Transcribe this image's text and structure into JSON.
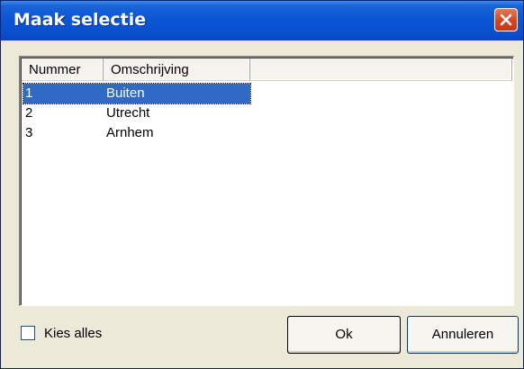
{
  "window": {
    "title": "Maak selectie"
  },
  "icons": {
    "close": "close-x-icon"
  },
  "colors": {
    "title_bar": "#0a4fcf",
    "selection": "#316ac5",
    "close_button": "#d5441c"
  },
  "list": {
    "columns": [
      "Nummer",
      "Omschrijving"
    ],
    "rows": [
      {
        "number": "1",
        "description": "Buiten",
        "selected": true
      },
      {
        "number": "2",
        "description": "Utrecht",
        "selected": false
      },
      {
        "number": "3",
        "description": "Arnhem",
        "selected": false
      }
    ]
  },
  "select_all": {
    "label": "Kies alles",
    "checked": false
  },
  "buttons": {
    "ok": "Ok",
    "cancel": "Annuleren"
  }
}
